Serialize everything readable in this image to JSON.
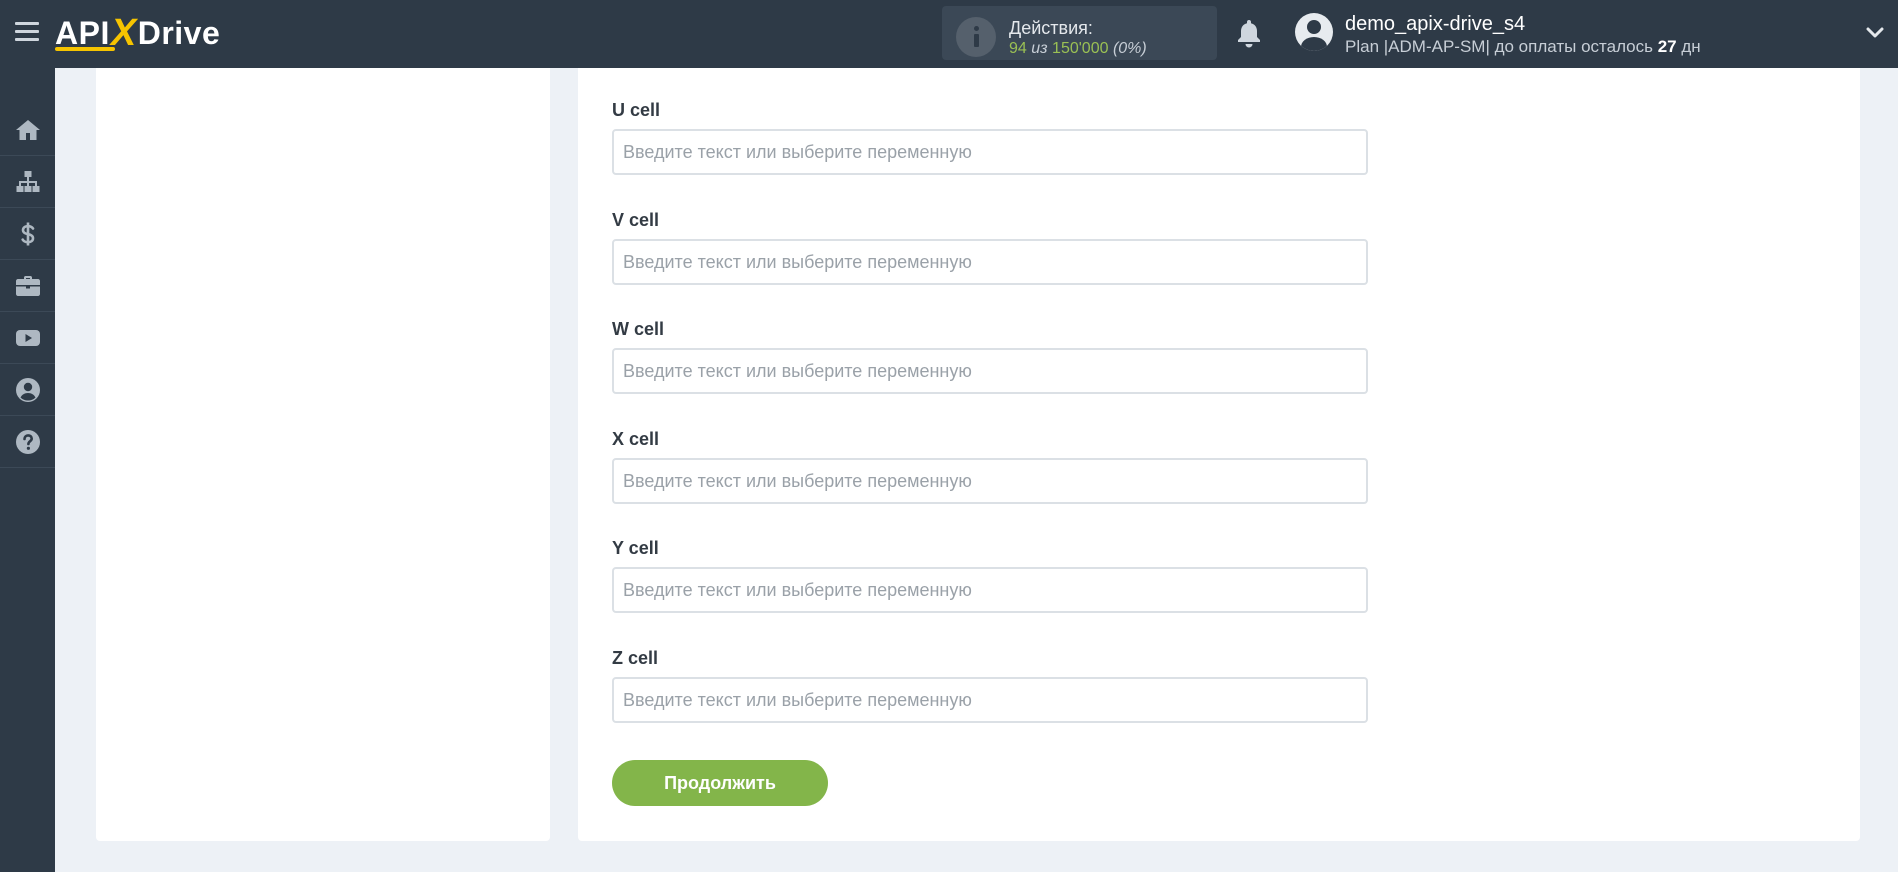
{
  "header": {
    "logo": {
      "part1": "API",
      "part2": "X",
      "part3": "Drive"
    },
    "actions": {
      "title": "Действия:",
      "used": "94",
      "separator": "из",
      "total": "150'000",
      "percent": "(0%)"
    },
    "user": {
      "name": "demo_apix-drive_s4",
      "plan_prefix": "Plan |ADM-AP-SM| до оплаты осталось ",
      "days": "27",
      "days_suffix": " дн"
    }
  },
  "sidebar": {
    "items": [
      {
        "icon": "home-icon"
      },
      {
        "icon": "sitemap-icon"
      },
      {
        "icon": "dollar-icon"
      },
      {
        "icon": "briefcase-icon"
      },
      {
        "icon": "youtube-icon"
      },
      {
        "icon": "user-circle-icon"
      },
      {
        "icon": "question-circle-icon"
      }
    ]
  },
  "form": {
    "fields": [
      {
        "label": "U cell",
        "value": "",
        "placeholder": "Введите текст или выберите переменную"
      },
      {
        "label": "V cell",
        "value": "",
        "placeholder": "Введите текст или выберите переменную"
      },
      {
        "label": "W cell",
        "value": "",
        "placeholder": "Введите текст или выберите переменную"
      },
      {
        "label": "X cell",
        "value": "",
        "placeholder": "Введите текст или выберите переменную"
      },
      {
        "label": "Y cell",
        "value": "",
        "placeholder": "Введите текст или выберите переменную"
      },
      {
        "label": "Z cell",
        "value": "",
        "placeholder": "Введите текст или выберите переменную"
      }
    ],
    "continue_label": "Продолжить"
  },
  "colors": {
    "topbar": "#2e3a47",
    "accent_green": "#83b54a",
    "logo_yellow": "#f6c400",
    "background": "#edf1f6"
  }
}
